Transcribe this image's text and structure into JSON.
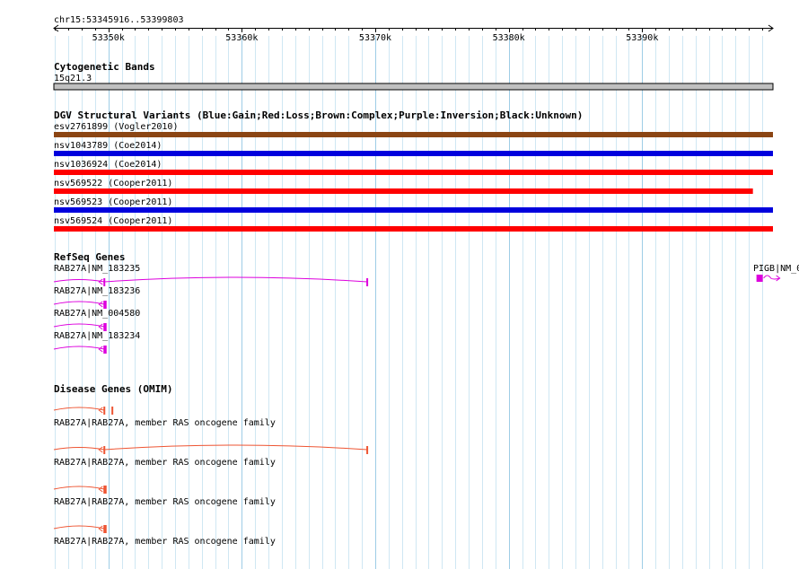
{
  "region": {
    "label": "chr15:53345916..53399803",
    "start": 53345916,
    "end": 53399803,
    "ticks": [
      {
        "pos": 53350000,
        "label": "53350k"
      },
      {
        "pos": 53360000,
        "label": "53360k"
      },
      {
        "pos": 53370000,
        "label": "53370k"
      },
      {
        "pos": 53380000,
        "label": "53380k"
      },
      {
        "pos": 53390000,
        "label": "53390k"
      }
    ],
    "grid_step": 1000
  },
  "tracks": {
    "cytoband": {
      "title": "Cytogenetic Bands",
      "band": {
        "name": "15q21.3",
        "start": 53345916,
        "end": 53399803,
        "color": "#c0c0c0"
      }
    },
    "dgv": {
      "title": "DGV Structural Variants (Blue:Gain;Red:Loss;Brown:Complex;Purple:Inversion;Black:Unknown)",
      "variants": [
        {
          "id": "esv2761899",
          "study": "(Vogler2010)",
          "start": 53345916,
          "end": 53399803,
          "color": "#8b4513"
        },
        {
          "id": "nsv1043789",
          "study": "(Coe2014)",
          "start": 53345916,
          "end": 53399803,
          "color": "#0000dd"
        },
        {
          "id": "nsv1036924",
          "study": "(Coe2014)",
          "start": 53345916,
          "end": 53399803,
          "color": "#ff0000"
        },
        {
          "id": "nsv569522",
          "study": "(Cooper2011)",
          "start": 53345916,
          "end": 53398300,
          "color": "#ff0000"
        },
        {
          "id": "nsv569523",
          "study": "(Cooper2011)",
          "start": 53345916,
          "end": 53399803,
          "color": "#0000dd"
        },
        {
          "id": "nsv569524",
          "study": "(Cooper2011)",
          "start": 53345916,
          "end": 53399803,
          "color": "#ff0000"
        }
      ]
    },
    "refseq": {
      "title": "RefSeq Genes",
      "color": "#dd00dd",
      "genes": [
        {
          "label": "RAB27A|NM_183235",
          "start": 53345916,
          "end": 53369400,
          "marker": 53349700
        },
        {
          "label": "RAB27A|NM_183236",
          "start": 53345916,
          "end": 53349800,
          "marker": 53349700
        },
        {
          "label": "RAB27A|NM_004580",
          "start": 53345916,
          "end": 53349800,
          "marker": 53349700
        },
        {
          "label": "RAB27A|NM_183234",
          "start": 53345916,
          "end": 53349800,
          "marker": 53349700
        }
      ],
      "right_gene": {
        "label": "PIGB|NM_0",
        "start": 53398500,
        "end": 53399803
      }
    },
    "omim": {
      "title": "Disease Genes (OMIM)",
      "color": "#ee5533",
      "genes": [
        {
          "label": "RAB27A|RAB27A, member RAS oncogene family",
          "start": 53345916,
          "end": 53350300,
          "marker": 53349700
        },
        {
          "label": "RAB27A|RAB27A, member RAS oncogene family",
          "start": 53345916,
          "end": 53369400,
          "marker": 53349700
        },
        {
          "label": "RAB27A|RAB27A, member RAS oncogene family",
          "start": 53345916,
          "end": 53349800,
          "marker": 53349700
        },
        {
          "label": "RAB27A|RAB27A, member RAS oncogene family",
          "start": 53345916,
          "end": 53349800,
          "marker": 53349700
        }
      ]
    }
  }
}
